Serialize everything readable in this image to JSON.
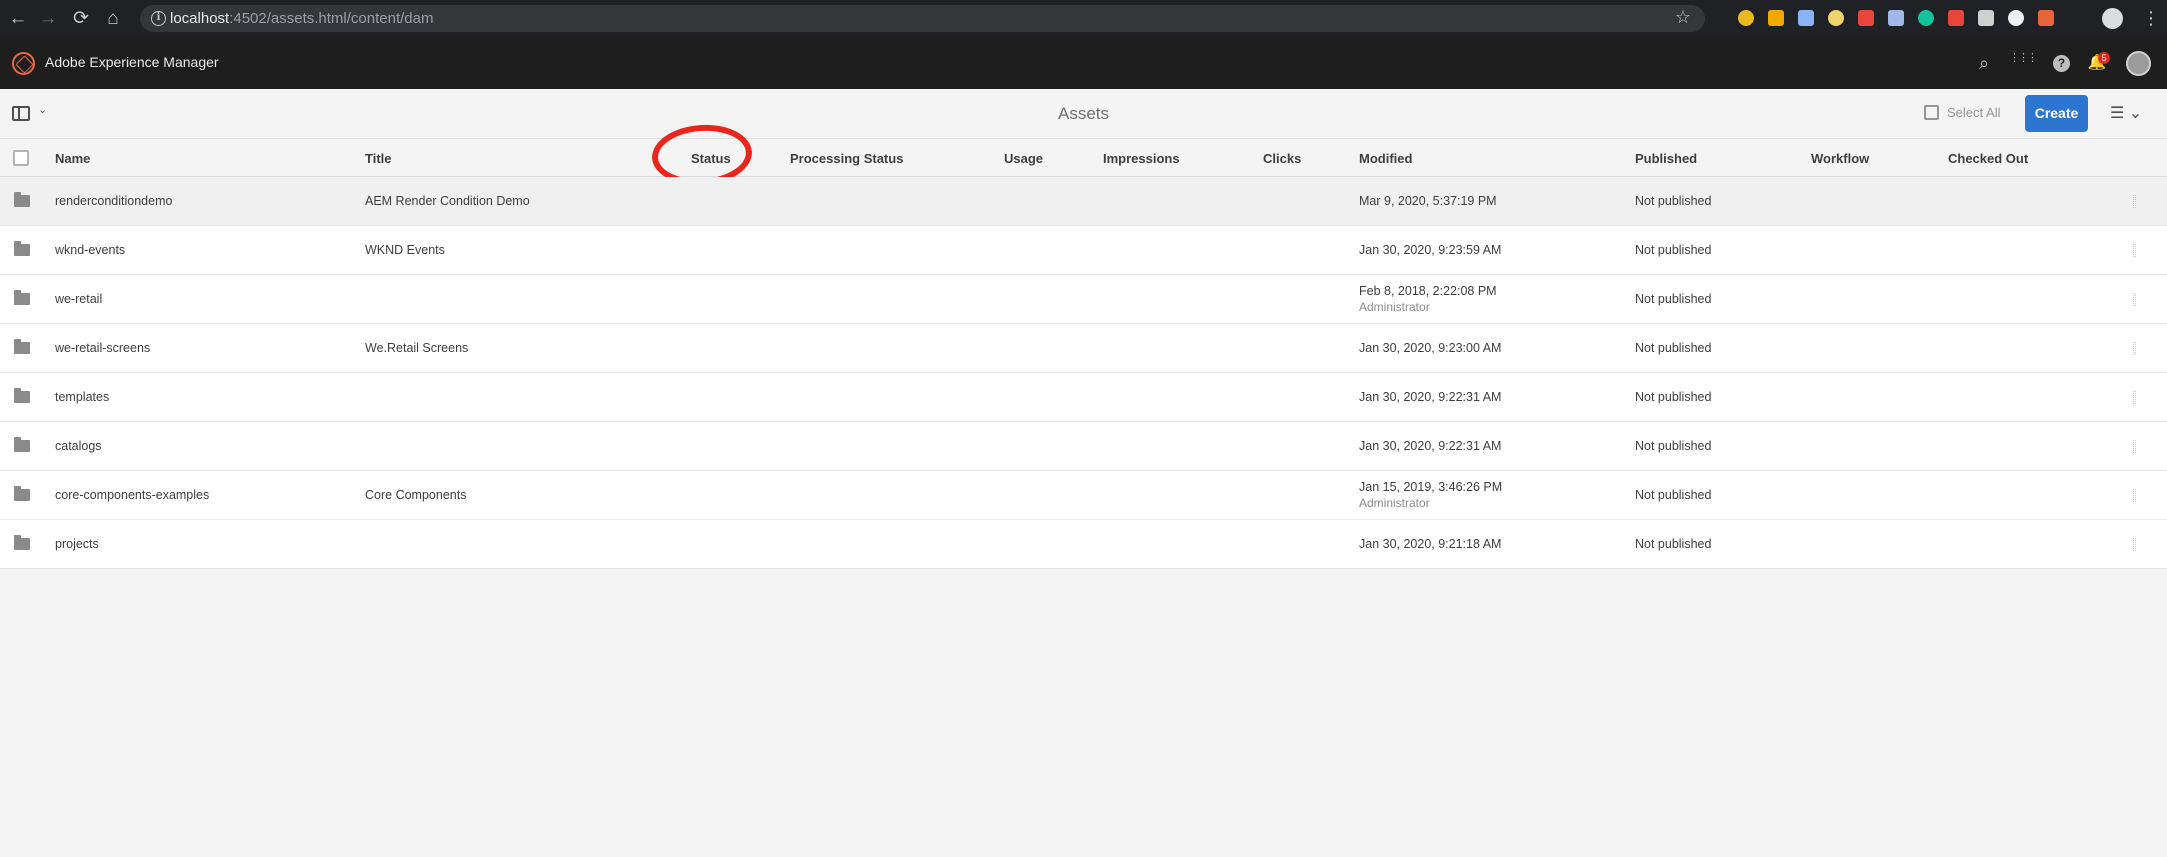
{
  "browser": {
    "url_host": "localhost",
    "url_path": ":4502/assets.html/content/dam",
    "back_icon": "←",
    "forward_icon": "→",
    "reload_icon": "⟳",
    "home_icon": "⌂",
    "info_icon": "i",
    "star_icon": "☆",
    "menu_icon": "⋮",
    "extension_colors": [
      "#e8b923",
      "#f2a900",
      "#8ab4f8",
      "#f1d36c",
      "#e8453c",
      "#a0b8e8",
      "#15c39a",
      "#e8453c",
      "#d0d0d0",
      "#f0f0f0",
      "#e8653c"
    ]
  },
  "shell": {
    "title": "Adobe Experience Manager",
    "search_icon": "⌕",
    "apps_icon": "⋮⋮⋮",
    "help_icon": "?",
    "bell_icon": "🔔",
    "notification_count": "5"
  },
  "actionbar": {
    "rail_caret": "⌄",
    "title": "Assets",
    "select_all": "Select All",
    "create": "Create",
    "view_icon": "☰ ⌄"
  },
  "columns": {
    "name": "Name",
    "title": "Title",
    "status": "Status",
    "processing_status": "Processing Status",
    "usage": "Usage",
    "impressions": "Impressions",
    "clicks": "Clicks",
    "modified": "Modified",
    "published": "Published",
    "workflow": "Workflow",
    "checked_out": "Checked Out"
  },
  "rows": [
    {
      "name": "renderconditiondemo",
      "title": "AEM Render Condition Demo",
      "modified": "Mar 9, 2020, 5:37:19 PM",
      "modified_by": "",
      "published": "Not published"
    },
    {
      "name": "wknd-events",
      "title": "WKND Events",
      "modified": "Jan 30, 2020, 9:23:59 AM",
      "modified_by": "",
      "published": "Not published"
    },
    {
      "name": "we-retail",
      "title": "",
      "modified": "Feb 8, 2018, 2:22:08 PM",
      "modified_by": "Administrator",
      "published": "Not published"
    },
    {
      "name": "we-retail-screens",
      "title": "We.Retail Screens",
      "modified": "Jan 30, 2020, 9:23:00 AM",
      "modified_by": "",
      "published": "Not published"
    },
    {
      "name": "templates",
      "title": "",
      "modified": "Jan 30, 2020, 9:22:31 AM",
      "modified_by": "",
      "published": "Not published"
    },
    {
      "name": "catalogs",
      "title": "",
      "modified": "Jan 30, 2020, 9:22:31 AM",
      "modified_by": "",
      "published": "Not published"
    },
    {
      "name": "core-components-examples",
      "title": "Core Components",
      "modified": "Jan 15, 2019, 3:46:26 PM",
      "modified_by": "Administrator",
      "published": "Not published"
    },
    {
      "name": "projects",
      "title": "",
      "modified": "Jan 30, 2020, 9:21:18 AM",
      "modified_by": "",
      "published": "Not published"
    }
  ]
}
